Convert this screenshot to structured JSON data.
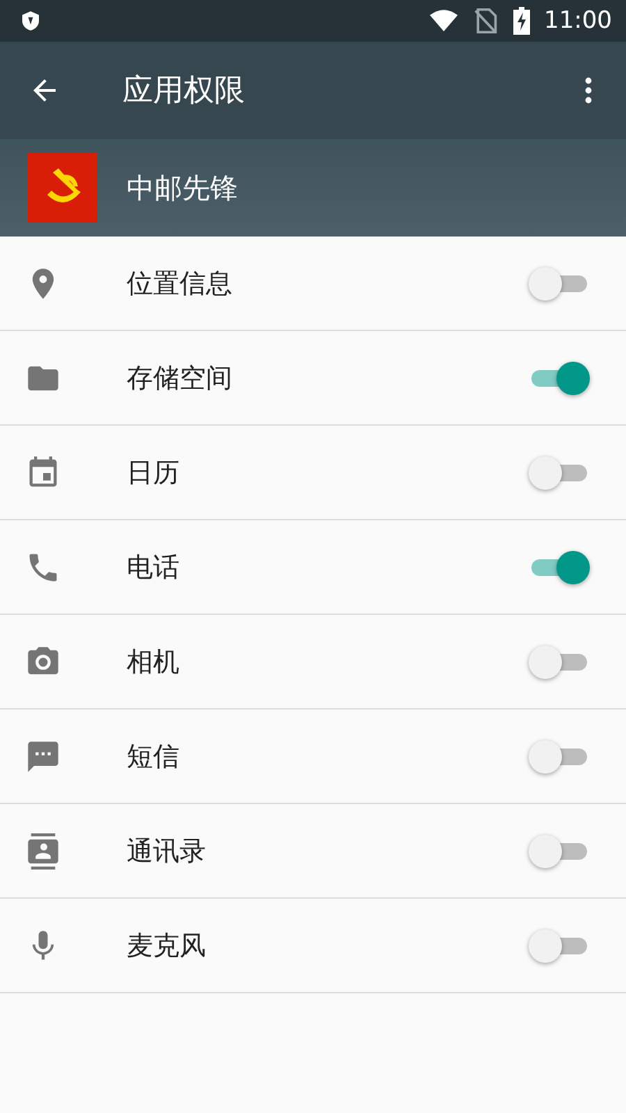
{
  "status_bar": {
    "time": "11:00"
  },
  "toolbar": {
    "title": "应用权限"
  },
  "app": {
    "name": "中邮先锋"
  },
  "permissions": [
    {
      "kind": "location",
      "label": "位置信息",
      "on": false
    },
    {
      "kind": "storage",
      "label": "存储空间",
      "on": true
    },
    {
      "kind": "calendar",
      "label": "日历",
      "on": false
    },
    {
      "kind": "phone",
      "label": "电话",
      "on": true
    },
    {
      "kind": "camera",
      "label": "相机",
      "on": false
    },
    {
      "kind": "sms",
      "label": "短信",
      "on": false
    },
    {
      "kind": "contacts",
      "label": "通讯录",
      "on": false
    },
    {
      "kind": "microphone",
      "label": "麦克风",
      "on": false
    }
  ]
}
